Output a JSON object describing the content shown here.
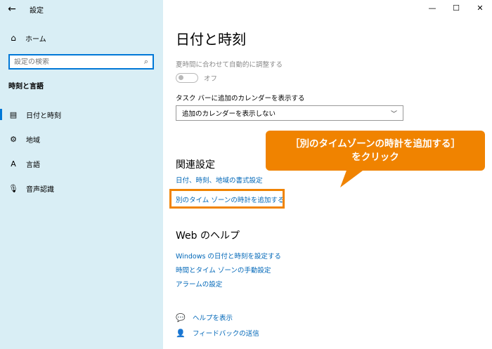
{
  "window": {
    "title": "設定",
    "minimize": "—",
    "maximize": "☐",
    "close": "✕"
  },
  "sidebar": {
    "back_icon": "←",
    "home": {
      "icon": "⌂",
      "label": "ホーム"
    },
    "search": {
      "placeholder": "設定の検索",
      "icon": "⌕"
    },
    "section": "時刻と言語",
    "items": [
      {
        "icon": "▤",
        "label": "日付と時刻",
        "active": true
      },
      {
        "icon": "⚙",
        "label": "地域",
        "active": false
      },
      {
        "icon": "A",
        "label": "言語",
        "active": false
      },
      {
        "icon": "🎙",
        "label": "音声認識",
        "active": false
      }
    ]
  },
  "main": {
    "title": "日付と時刻",
    "dst_label": "夏時間に合わせて自動的に調整する",
    "toggle_text": "オフ",
    "taskbar_label": "タスク バーに追加のカレンダーを表示する",
    "dropdown_value": "追加のカレンダーを表示しない",
    "related_title": "関連設定",
    "related_links": [
      "日付、時刻、地域の書式設定",
      "別のタイム ゾーンの時計を追加する"
    ],
    "web_help_title": "Web のヘルプ",
    "web_links": [
      "Windows の日付と時刻を設定する",
      "時間とタイム ゾーンの手動設定",
      "アラームの設定"
    ],
    "help": {
      "icon": "💬",
      "label": "ヘルプを表示"
    },
    "feedback": {
      "icon": "👤",
      "label": "フィードバックの送信"
    }
  },
  "callout": {
    "line1": "［別のタイムゾーンの時計を追加する］",
    "line2": "をクリック"
  },
  "colors": {
    "accent": "#0078d7",
    "link": "#0067b8",
    "callout": "#f08300",
    "sidebar_bg": "#d9eef5"
  }
}
